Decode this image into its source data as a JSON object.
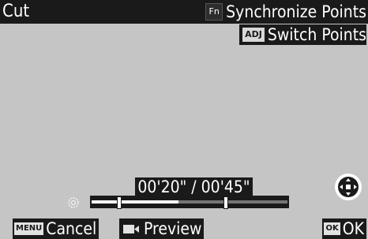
{
  "header": {
    "title": "Cut",
    "fn_key": "Fn",
    "fn_action": "Synchronize Points",
    "adj_key": "ADJ",
    "adj_action": "Switch Points"
  },
  "playback": {
    "time_display": "00'20\" / 00'45\"",
    "elapsed_fraction": 0.444
  },
  "footer": {
    "menu_key": "MENU",
    "menu_action": "Cancel",
    "preview_action": "Preview",
    "ok_key": "OK",
    "ok_action": "OK"
  },
  "icons": {
    "loop": "loop-icon",
    "dpad": "four-way-controller-icon",
    "preview": "movie-camera-icon"
  },
  "colors": {
    "bar": "#1a1a1a",
    "background": "#c5c5c5",
    "text": "#ffffff",
    "track_rest": "#777777"
  }
}
